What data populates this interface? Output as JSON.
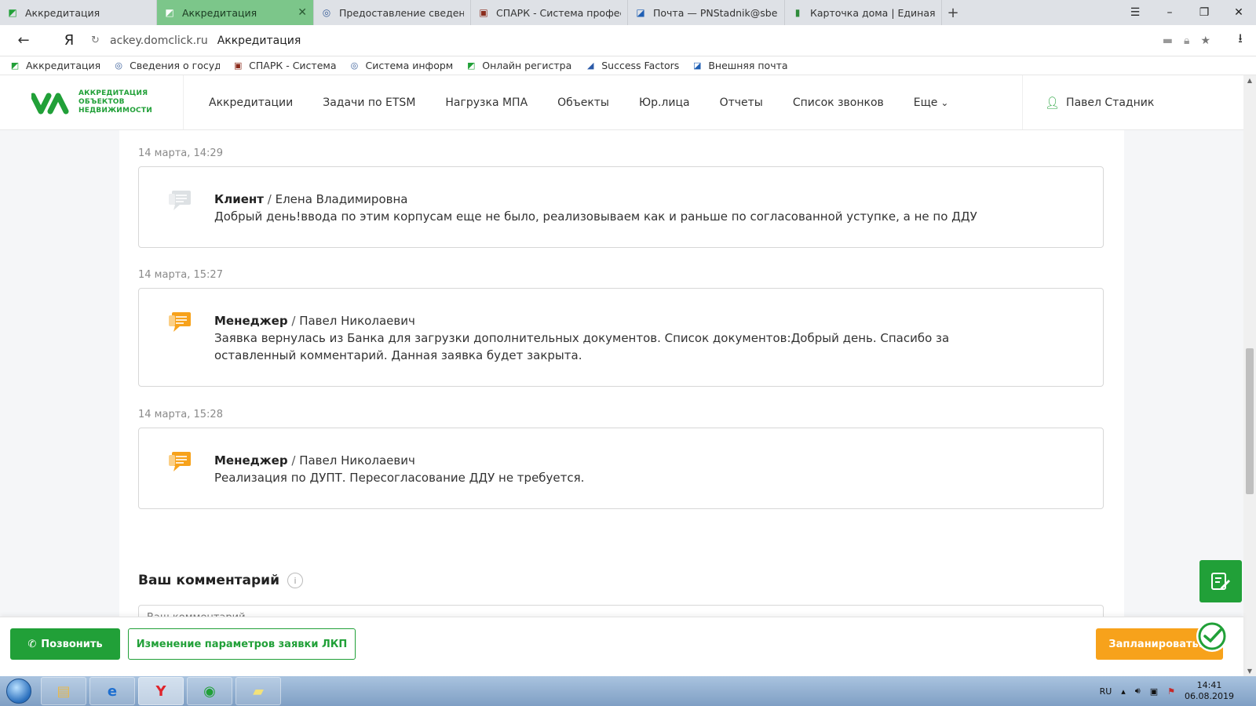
{
  "browser": {
    "tabs": [
      {
        "label": "Аккредитация",
        "icon": "domclick-icon",
        "active": false
      },
      {
        "label": "Аккредитация",
        "icon": "domclick-icon",
        "active": true
      },
      {
        "label": "Предоставление сведений",
        "icon": "gov-icon",
        "active": false
      },
      {
        "label": "СПАРК - Система професси",
        "icon": "spark-icon",
        "active": false
      },
      {
        "label": "Почта — PNStadnik@sberb",
        "icon": "outlook-icon",
        "active": false
      },
      {
        "label": "Карточка дома | Единая ин",
        "icon": "chart-icon",
        "active": false
      }
    ],
    "new_tab": "+",
    "address": {
      "host": "ackey.domclick.ru",
      "title": "Аккредитация"
    },
    "bookmarks": [
      {
        "label": "Аккредитация",
        "icon": "domclick-icon"
      },
      {
        "label": "Сведения о госуда",
        "icon": "gov-icon"
      },
      {
        "label": "СПАРК - Система",
        "icon": "spark-icon"
      },
      {
        "label": "Система информ",
        "icon": "gov-icon"
      },
      {
        "label": "Онлайн регистрац",
        "icon": "domclick-icon"
      },
      {
        "label": "Success Factors",
        "icon": "sf-icon"
      },
      {
        "label": "Внешняя почта",
        "icon": "outlook-icon"
      }
    ]
  },
  "header": {
    "logo_lines": [
      "АККРЕДИТАЦИЯ",
      "ОБЪЕКТОВ",
      "НЕДВИЖИМОСТИ"
    ],
    "nav": [
      "Аккредитации",
      "Задачи по ETSM",
      "Нагрузка МПА",
      "Объекты",
      "Юр.лица",
      "Отчеты",
      "Список звонков",
      "Еще"
    ],
    "user": "Павел Стадник"
  },
  "messages": [
    {
      "time": "14 марта, 14:29",
      "role": "Клиент",
      "name": "Елена Владимировна",
      "text": "Добрый день!ввода по этим корпусам еще не было, реализовываем как и раньше по согласованной уступке, а не по ДДУ",
      "icon_color": "#c8cdd2"
    },
    {
      "time": "14 марта, 15:27",
      "role": "Менеджер",
      "name": "Павел Николаевич",
      "text": "Заявка вернулась из Банка для загрузки дополнительных документов. Список документов:Добрый день. Спасибо за оставленный комментарий. Данная заявка будет закрыта.",
      "icon_color": "#f7a21b"
    },
    {
      "time": "14 марта, 15:28",
      "role": "Менеджер",
      "name": "Павел Николаевич",
      "text": "Реализация по ДУПТ. Пересогласование ДДУ не требуется.",
      "icon_color": "#f7a21b"
    }
  ],
  "comment": {
    "title": "Ваш комментарий",
    "info": "i",
    "placeholder": "Ваш комментарий"
  },
  "actions": {
    "call": "Позвонить",
    "change": "Изменение параметров заявки ЛКП",
    "plan": "Запланировать..."
  },
  "taskbar": {
    "lang": "RU",
    "time": "14:41",
    "date": "06.08.2019"
  },
  "colors": {
    "brand_green": "#21a038",
    "accent_orange": "#f7a21b"
  }
}
